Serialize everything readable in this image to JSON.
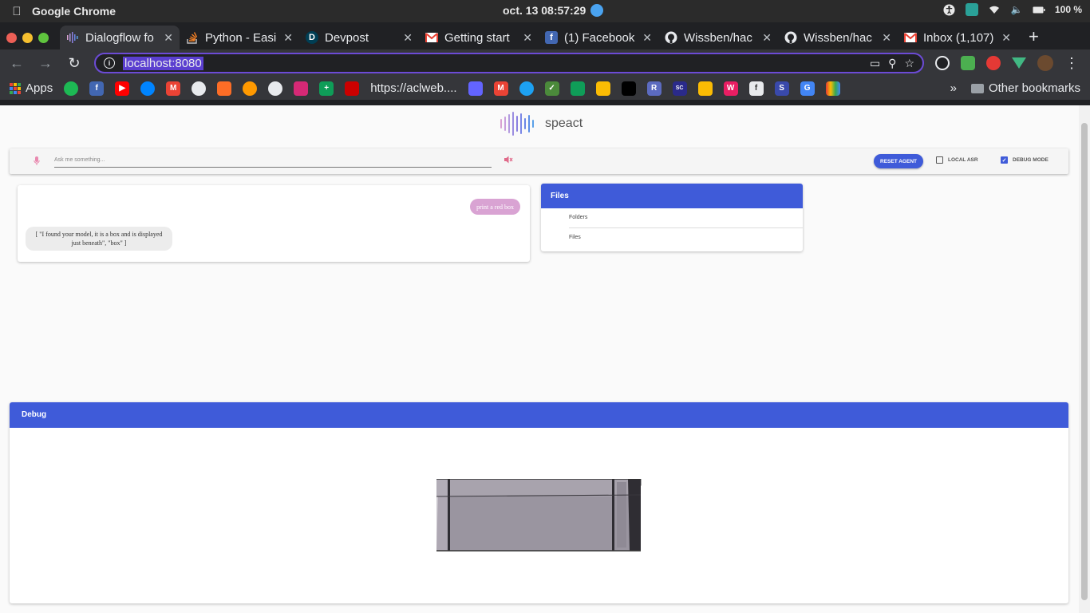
{
  "os": {
    "app_name": "Google Chrome",
    "clock": "oct. 13  08:57:29",
    "battery": "100 %"
  },
  "tabs": [
    {
      "title": "Dialogflow fo",
      "favicon": "speact-icon",
      "active": true
    },
    {
      "title": "Python - Easie",
      "favicon": "stackoverflow-icon",
      "active": false
    },
    {
      "title": "Devpost",
      "favicon": "devpost-icon",
      "active": false
    },
    {
      "title": "Getting start",
      "favicon": "gmail-icon",
      "active": false
    },
    {
      "title": "(1) Facebook",
      "favicon": "facebook-icon",
      "active": false
    },
    {
      "title": "Wissben/hac",
      "favicon": "github-icon",
      "active": false
    },
    {
      "title": "Wissben/hac",
      "favicon": "github-icon",
      "active": false
    },
    {
      "title": "Inbox (1,107)",
      "favicon": "gmail-icon",
      "active": false
    }
  ],
  "toolbar": {
    "url": "localhost:8080"
  },
  "bookmarks": {
    "apps_label": "Apps",
    "link_text": "https://aclweb....",
    "other_label": "Other bookmarks",
    "more_label": "»"
  },
  "app": {
    "brand_name": "speact",
    "input_placeholder": "Ask me something...",
    "reset_label": "RESET AGENT",
    "local_asr_label": "LOCAL ASR",
    "local_asr_checked": false,
    "debug_mode_label": "DEBUG MODE",
    "debug_mode_checked": true
  },
  "chat": {
    "user_message": "print a red box",
    "bot_message": "[ \"I found your model, it is a box and is displayed just beneath\", \"box\" ]"
  },
  "files": {
    "header": "Files",
    "items": [
      "Folders",
      "Files"
    ]
  },
  "debug": {
    "header": "Debug",
    "model_shape": "box"
  },
  "colors": {
    "accent": "#3f5bd9",
    "user_bubble": "#d9a3d3",
    "model_fill": "#9a95a0"
  }
}
